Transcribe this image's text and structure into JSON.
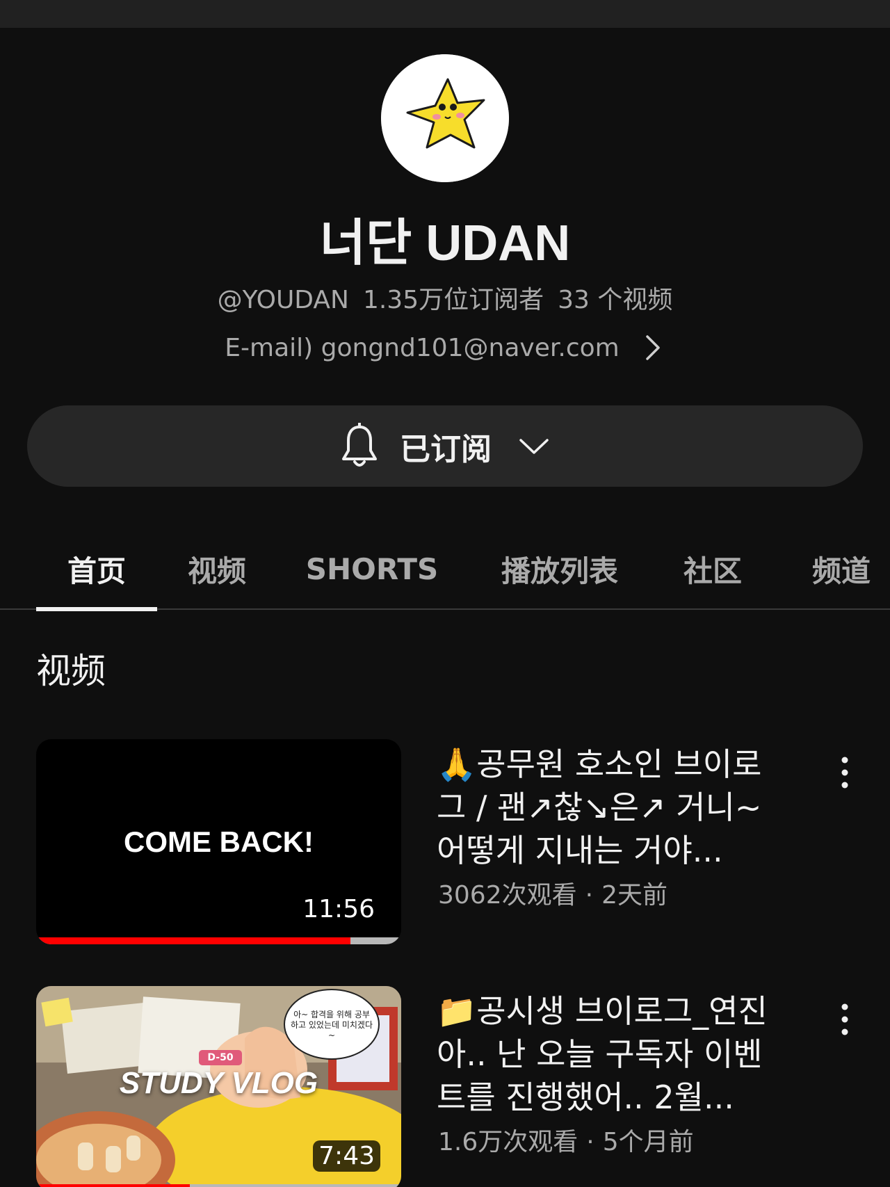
{
  "channel": {
    "name": "너단 UDAN",
    "handle": "@YOUDAN",
    "subscribers": "1.35万位订阅者",
    "video_count": "33 个视频",
    "description": "E-mail) gongnd101@naver.com"
  },
  "subscribe": {
    "label": "已订阅"
  },
  "tabs": [
    {
      "label": "首页",
      "active": true
    },
    {
      "label": "视频"
    },
    {
      "label": "SHORTS"
    },
    {
      "label": "播放列表"
    },
    {
      "label": "社区"
    },
    {
      "label": "频道"
    }
  ],
  "section": {
    "title": "视频"
  },
  "videos": [
    {
      "thumb_text": "COME BACK!",
      "duration": "11:56",
      "watched_fraction": 0.86,
      "title": "🙏공무원 호소인 브이로그 / 괜↗찮↘은↗ 거니~ 어떻게 지내는 거야...",
      "views": "3062次观看",
      "age": "2天前"
    },
    {
      "thumb_text": "STUDY VLOG",
      "thumb_badge": "D-50",
      "thumb_bubble": "아~ 합격을 위해 공부하고 있었는데 미치겠다~",
      "duration": "7:43",
      "watched_fraction": 0.42,
      "title": "📁공시생 브이로그_연진아.. 난 오늘 구독자 이벤트를 진행했어.. 2월...",
      "views": "1.6万次观看",
      "age": "5个月前"
    }
  ],
  "colors": {
    "background": "#0f0f0f",
    "button_bg": "#272727",
    "progress_red": "#ff0000",
    "secondary_text": "#aaaaaa"
  }
}
